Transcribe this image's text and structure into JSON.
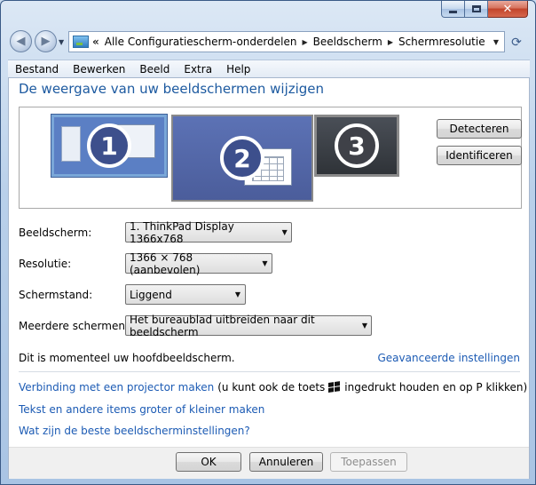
{
  "window": {
    "caption_buttons": [
      "minimize-icon",
      "maximize-icon",
      "close-icon"
    ]
  },
  "nav": {
    "back_icon": "back-arrow-icon",
    "forward_icon": "forward-arrow-icon",
    "address": {
      "icon": "control-panel-icon",
      "overflow": "«",
      "breadcrumbs": [
        "Alle Configuratiescherm-onderdelen",
        "Beeldscherm",
        "Schermresolutie"
      ]
    },
    "refresh_icon": "refresh-icon"
  },
  "menu": {
    "items": [
      {
        "label": "Bestand"
      },
      {
        "label": "Bewerken"
      },
      {
        "label": "Beeld"
      },
      {
        "label": "Extra"
      },
      {
        "label": "Help"
      }
    ]
  },
  "main": {
    "title": "De weergave van uw beeldschermen wijzigen",
    "monitors": [
      {
        "number": "1"
      },
      {
        "number": "2"
      },
      {
        "number": "3"
      }
    ],
    "detect_button": "Detecteren",
    "identify_button": "Identificeren",
    "fields": [
      {
        "label": "Beeldscherm:",
        "value": "1. ThinkPad Display 1366x768"
      },
      {
        "label": "Resolutie:",
        "value": "1366 × 768 (aanbevolen)"
      },
      {
        "label": "Schermstand:",
        "value": "Liggend"
      },
      {
        "label": "Meerdere schermen:",
        "value": "Het bureaublad uitbreiden naar dit beeldscherm"
      }
    ],
    "info_text": "Dit is momenteel uw hoofdbeeldscherm.",
    "advanced_link": "Geavanceerde instellingen",
    "projector_link": "Verbinding met een projector maken",
    "projector_hint_pre": "(u kunt ook de toets",
    "projector_hint_post": "ingedrukt houden en op P klikken)",
    "text_size_link": "Tekst en andere items groter of kleiner maken",
    "best_settings_link": "Wat zijn de beste beeldscherminstellingen?"
  },
  "footer": {
    "ok": "OK",
    "cancel": "Annuleren",
    "apply": "Toepassen"
  }
}
